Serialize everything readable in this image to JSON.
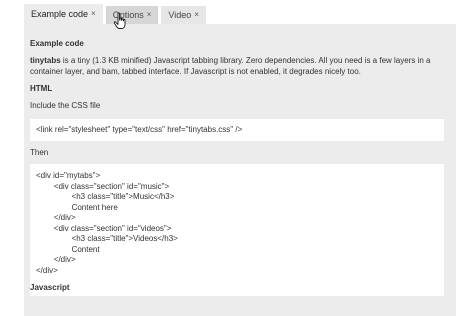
{
  "tabs": [
    {
      "label": "Example code",
      "close": "×",
      "state": "active"
    },
    {
      "label": "Options",
      "close": "×",
      "state": "hover"
    },
    {
      "label": "Video",
      "close": "×",
      "state": "normal"
    }
  ],
  "panel": {
    "title": "Example code",
    "intro_strong": "tinytabs",
    "intro_rest": " is a tiny (1.3 KB minified) Javascript tabbing library. Zero dependencies. All you need is a few layers in a container layer, and bam, tabbed interface. If Javascript is not enabled, it degrades nicely too.",
    "html_heading": "HTML",
    "include_css": "Include the CSS file",
    "css_code": "<link rel=\"stylesheet\" type=\"text/css\" href=\"tinytabs.css\" />",
    "then": "Then",
    "markup_lines": [
      "<div id=\"mytabs\">",
      "        <div class=\"section\" id=\"music\">",
      "                <h3 class=\"title\">Music</h3>",
      "                Content here",
      "        </div>",
      "        <div class=\"section\" id=\"videos\">",
      "                <h3 class=\"title\">Videos</h3>",
      "                Content",
      "        </div>",
      "</div>"
    ],
    "js_heading": "Javascript"
  },
  "colors": {
    "panel_bg": "#ececec",
    "tab_bg": "#e6e6e6",
    "code_bg": "#ffffff",
    "text": "#333333"
  },
  "cursor_icon": "hand-pointer-icon"
}
